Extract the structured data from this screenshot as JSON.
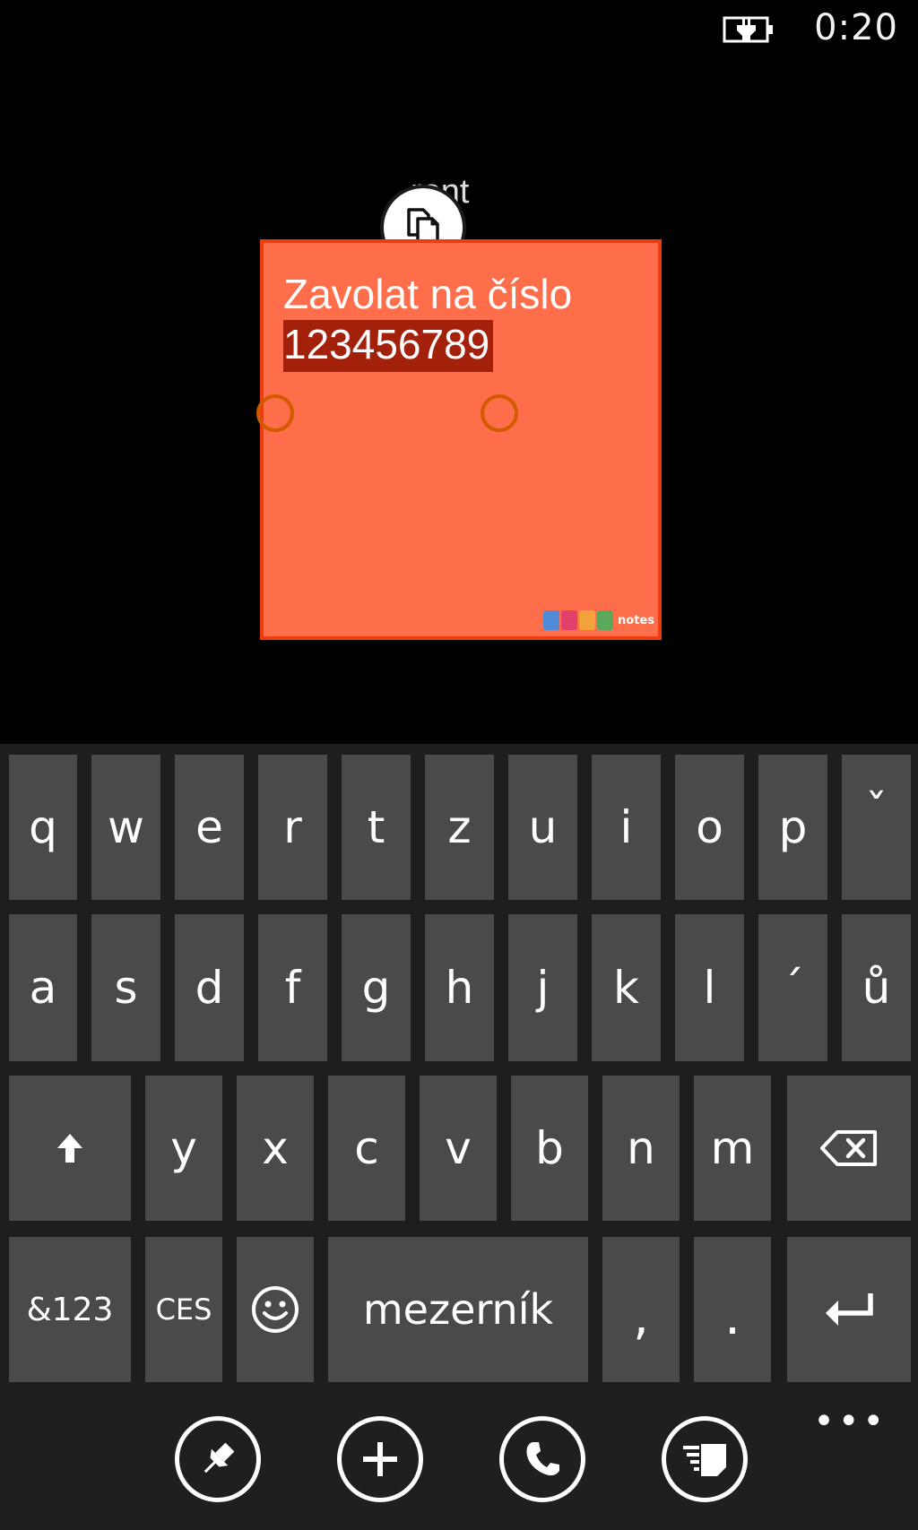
{
  "status_bar": {
    "time": "0:20",
    "battery_icon": "battery-charging-icon"
  },
  "note": {
    "title_behind": "ront",
    "line1": "Zavolat na číslo",
    "line2": "123456789",
    "background_color": "#ff6e4a",
    "border_color": "#ee3c12",
    "selection_color": "#a3200a",
    "app_logo_text": "notes",
    "copy_icon": "copy-icon"
  },
  "keyboard": {
    "row1": [
      "q",
      "w",
      "e",
      "r",
      "t",
      "z",
      "u",
      "i",
      "o",
      "p",
      "ˇ"
    ],
    "row2": [
      "a",
      "s",
      "d",
      "f",
      "g",
      "h",
      "j",
      "k",
      "l",
      "´",
      "ů"
    ],
    "row3": {
      "shift_icon": "shift-arrow-icon",
      "letters": [
        "y",
        "x",
        "c",
        "v",
        "b",
        "n",
        "m"
      ],
      "backspace_icon": "backspace-icon"
    },
    "row4": {
      "symbols_label": "&123",
      "language_label": "CES",
      "emoji_icon": "smiley-icon",
      "space_label": "mezerník",
      "comma": ",",
      "period": ".",
      "enter_icon": "enter-icon"
    }
  },
  "app_bar": {
    "buttons": [
      "pin-icon",
      "add-icon",
      "phone-icon",
      "notes-list-icon"
    ],
    "more_label": "•••"
  }
}
